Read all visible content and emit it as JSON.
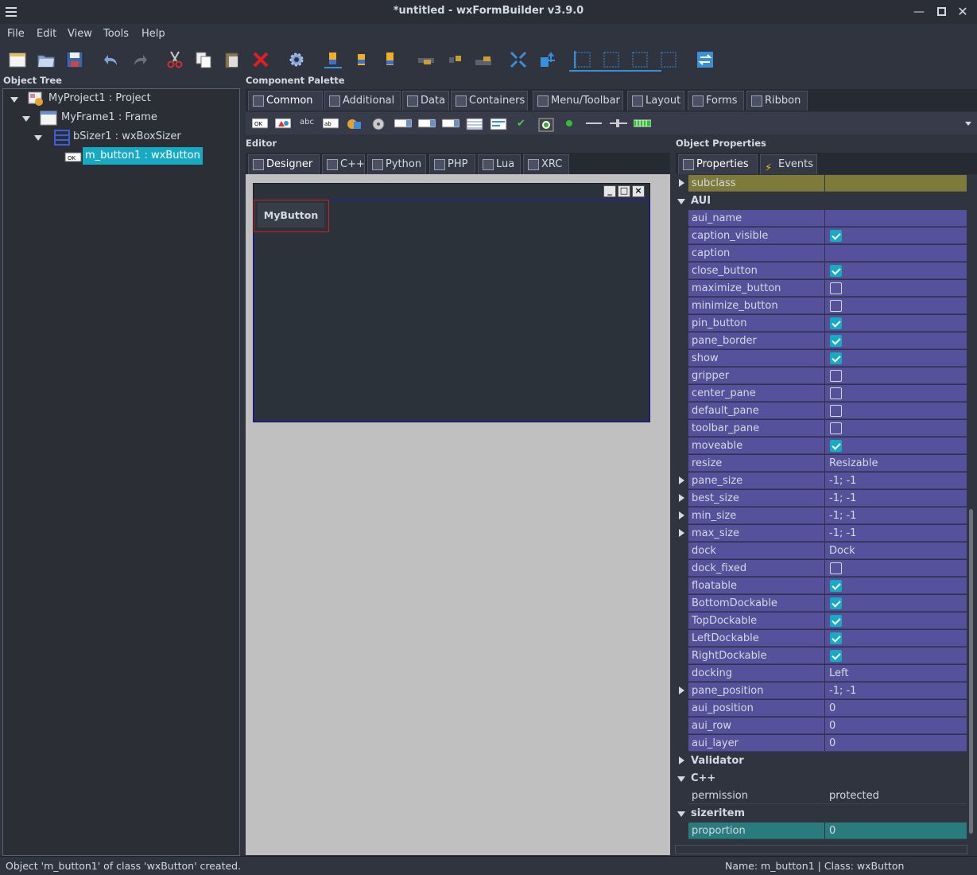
{
  "window": {
    "title": "*untitled - wxFormBuilder v3.9.0"
  },
  "menu": [
    "File",
    "Edit",
    "View",
    "Tools",
    "Help"
  ],
  "panels": {
    "object_tree": "Object Tree",
    "component_palette": "Component Palette",
    "editor": "Editor",
    "object_properties": "Object Properties"
  },
  "tree": [
    {
      "label": "MyProject1 : Project"
    },
    {
      "label": "MyFrame1 : Frame"
    },
    {
      "label": "bSizer1 : wxBoxSizer"
    },
    {
      "label": "m_button1 : wxButton",
      "selected": true
    }
  ],
  "palette_tabs": [
    "Common",
    "Additional",
    "Data",
    "Containers",
    "Menu/Toolbar",
    "Layout",
    "Forms",
    "Ribbon"
  ],
  "editor_tabs": [
    "Designer",
    "C++",
    "Python",
    "PHP",
    "Lua",
    "XRC"
  ],
  "prop_tabs": [
    "Properties",
    "Events"
  ],
  "button_label": "MyButton",
  "props": [
    {
      "n": "subclass",
      "v": "",
      "style": "olive",
      "exp": "r"
    },
    {
      "n": "AUI",
      "cat": true,
      "exp": "d"
    },
    {
      "n": "aui_name",
      "v": ""
    },
    {
      "n": "caption_visible",
      "cb": true
    },
    {
      "n": "caption",
      "v": ""
    },
    {
      "n": "close_button",
      "cb": true
    },
    {
      "n": "maximize_button",
      "cb": false
    },
    {
      "n": "minimize_button",
      "cb": false
    },
    {
      "n": "pin_button",
      "cb": true
    },
    {
      "n": "pane_border",
      "cb": true
    },
    {
      "n": "show",
      "cb": true
    },
    {
      "n": "gripper",
      "cb": false
    },
    {
      "n": "center_pane",
      "cb": false
    },
    {
      "n": "default_pane",
      "cb": false
    },
    {
      "n": "toolbar_pane",
      "cb": false
    },
    {
      "n": "moveable",
      "cb": true
    },
    {
      "n": "resize",
      "v": "Resizable"
    },
    {
      "n": "pane_size",
      "v": "-1; -1",
      "exp": "r"
    },
    {
      "n": "best_size",
      "v": "-1; -1",
      "exp": "r"
    },
    {
      "n": "min_size",
      "v": "-1; -1",
      "exp": "r"
    },
    {
      "n": "max_size",
      "v": "-1; -1",
      "exp": "r"
    },
    {
      "n": "dock",
      "v": "Dock"
    },
    {
      "n": "dock_fixed",
      "cb": false
    },
    {
      "n": "floatable",
      "cb": true
    },
    {
      "n": "BottomDockable",
      "cb": true
    },
    {
      "n": "TopDockable",
      "cb": true
    },
    {
      "n": "LeftDockable",
      "cb": true
    },
    {
      "n": "RightDockable",
      "cb": true
    },
    {
      "n": "docking",
      "v": "Left"
    },
    {
      "n": "pane_position",
      "v": "-1; -1",
      "exp": "r"
    },
    {
      "n": "aui_position",
      "v": "0"
    },
    {
      "n": "aui_row",
      "v": "0"
    },
    {
      "n": "aui_layer",
      "v": "0"
    },
    {
      "n": "Validator",
      "cat": true,
      "exp": "r"
    },
    {
      "n": "C++",
      "cat": true,
      "exp": "d"
    },
    {
      "n": "permission",
      "v": "protected",
      "style": "plain"
    },
    {
      "n": "sizeritem",
      "cat": true,
      "exp": "d"
    },
    {
      "n": "proportion",
      "v": "0",
      "style": "teal"
    }
  ],
  "status": {
    "left": "Object 'm_button1' of class 'wxButton' created.",
    "right": "Name: m_button1 | Class: wxButton"
  }
}
